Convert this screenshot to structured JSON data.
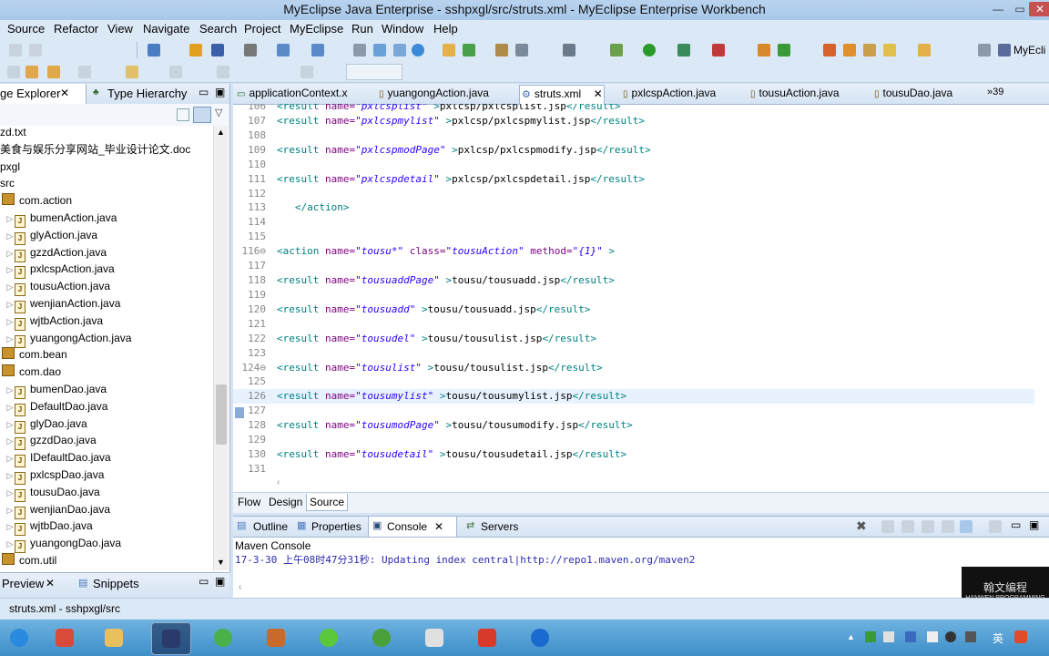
{
  "window": {
    "title": "MyEclipse Java Enterprise - sshpxgl/src/struts.xml - MyEclipse Enterprise Workbench",
    "minimize": "—",
    "maximize": "▭",
    "close": "✕"
  },
  "menu": [
    "Source",
    "Refactor",
    "View",
    "Navigate",
    "Search",
    "Project",
    "MyEclipse",
    "Run",
    "Window",
    "Help"
  ],
  "toolbar": {
    "perspective_label": "MyEcli",
    "icons": [
      "new-icon",
      "save-icon",
      "run-icon",
      "debug-icon",
      "server-icon",
      "search-icon",
      "open-folder-icon"
    ]
  },
  "left_panel": {
    "tabs": [
      "ge Explorer",
      "Type Hierarchy"
    ],
    "tree": [
      {
        "label": "zd.txt",
        "kind": "file",
        "indent": 0
      },
      {
        "label": "美食与娱乐分享网站_毕业设计论文.doc",
        "kind": "file",
        "indent": 0
      },
      {
        "label": "pxgl",
        "kind": "project",
        "indent": 0
      },
      {
        "label": "src",
        "kind": "folder",
        "indent": 0
      },
      {
        "label": "com.action",
        "kind": "package",
        "indent": 1
      },
      {
        "label": "bumenAction.java",
        "kind": "java",
        "indent": 2
      },
      {
        "label": "glyAction.java",
        "kind": "java",
        "indent": 2
      },
      {
        "label": "gzzdAction.java",
        "kind": "java",
        "indent": 2
      },
      {
        "label": "pxlcspAction.java",
        "kind": "java",
        "indent": 2
      },
      {
        "label": "tousuAction.java",
        "kind": "java",
        "indent": 2
      },
      {
        "label": "wenjianAction.java",
        "kind": "java",
        "indent": 2
      },
      {
        "label": "wjtbAction.java",
        "kind": "java",
        "indent": 2
      },
      {
        "label": "yuangongAction.java",
        "kind": "java",
        "indent": 2
      },
      {
        "label": "com.bean",
        "kind": "package",
        "indent": 1
      },
      {
        "label": "com.dao",
        "kind": "package",
        "indent": 1
      },
      {
        "label": "bumenDao.java",
        "kind": "java",
        "indent": 2
      },
      {
        "label": "DefaultDao.java",
        "kind": "java",
        "indent": 2
      },
      {
        "label": "glyDao.java",
        "kind": "java",
        "indent": 2
      },
      {
        "label": "gzzdDao.java",
        "kind": "java",
        "indent": 2
      },
      {
        "label": "IDefaultDao.java",
        "kind": "java",
        "indent": 2
      },
      {
        "label": "pxlcspDao.java",
        "kind": "java",
        "indent": 2
      },
      {
        "label": "tousuDao.java",
        "kind": "java",
        "indent": 2
      },
      {
        "label": "wenjianDao.java",
        "kind": "java",
        "indent": 2
      },
      {
        "label": "wjtbDao.java",
        "kind": "java",
        "indent": 2
      },
      {
        "label": "yuangongDao.java",
        "kind": "java",
        "indent": 2
      },
      {
        "label": "com.util",
        "kind": "package",
        "indent": 1
      }
    ],
    "bottom_tabs": [
      "Preview",
      "Snippets"
    ]
  },
  "editor": {
    "tabs": [
      {
        "label": "applicationContext.x",
        "active": false
      },
      {
        "label": "yuangongAction.java",
        "active": false
      },
      {
        "label": "struts.xml",
        "active": true
      },
      {
        "label": "pxlcspAction.java",
        "active": false
      },
      {
        "label": "tousuAction.java",
        "active": false
      },
      {
        "label": "tousuDao.java",
        "active": false
      }
    ],
    "overflow_count": "»39",
    "lines": [
      {
        "n": "106",
        "indent": "",
        "name": "pxlcsplist",
        "path": "pxlcsp/pxlcsplist.jsp"
      },
      {
        "n": "107",
        "indent": "",
        "name": "pxlcspmylist",
        "path": "pxlcsp/pxlcspmylist.jsp"
      },
      {
        "n": "108",
        "indent": "",
        "blank": true
      },
      {
        "n": "109",
        "indent": "",
        "name": "pxlcspmodPage",
        "path": "pxlcsp/pxlcspmodify.jsp"
      },
      {
        "n": "110",
        "indent": "",
        "blank": true
      },
      {
        "n": "111",
        "indent": "",
        "name": "pxlcspdetail",
        "path": "pxlcsp/pxlcspdetail.jsp"
      },
      {
        "n": "112",
        "indent": "",
        "blank": true
      },
      {
        "n": "113",
        "indent": "   ",
        "raw": "</action>"
      },
      {
        "n": "114",
        "indent": "",
        "blank": true
      },
      {
        "n": "115",
        "indent": "",
        "blank": true
      },
      {
        "n": "116⊖",
        "indent": "",
        "action": true,
        "a_name": "tousu*",
        "a_class": "tousuAction",
        "a_method": "{1}"
      },
      {
        "n": "117",
        "indent": "",
        "blank": true
      },
      {
        "n": "118",
        "indent": "",
        "name": "tousuaddPage",
        "path": "tousu/tousuadd.jsp"
      },
      {
        "n": "119",
        "indent": "",
        "blank": true
      },
      {
        "n": "120",
        "indent": "",
        "name": "tousuadd",
        "path": "tousu/tousuadd.jsp"
      },
      {
        "n": "121",
        "indent": "",
        "blank": true
      },
      {
        "n": "122",
        "indent": "",
        "name": "tousudel",
        "path": "tousu/tousulist.jsp"
      },
      {
        "n": "123",
        "indent": "",
        "blank": true
      },
      {
        "n": "124⊖",
        "indent": "",
        "name": "tousulist",
        "path": "tousu/tousulist.jsp"
      },
      {
        "n": "125",
        "indent": "",
        "blank": true
      },
      {
        "n": "126",
        "indent": "",
        "name": "tousumylist",
        "path": "tousu/tousumylist.jsp",
        "highlight": true
      },
      {
        "n": "127",
        "indent": "",
        "blank": true
      },
      {
        "n": "128",
        "indent": "",
        "name": "tousumodPage",
        "path": "tousu/tousumodify.jsp"
      },
      {
        "n": "129",
        "indent": "",
        "blank": true
      },
      {
        "n": "130",
        "indent": "",
        "name": "tousudetail",
        "path": "tousu/tousudetail.jsp"
      },
      {
        "n": "131",
        "indent": "",
        "blank": true
      }
    ],
    "view_tabs": [
      "Flow",
      "Design",
      "Source"
    ]
  },
  "bottom_panel": {
    "tabs": [
      "Outline",
      "Properties",
      "Console",
      "Servers"
    ],
    "active_tab": "Console",
    "console_title": "Maven Console",
    "console_line": "17-3-30 上午08时47分31秒: Updating index central|http://repo1.maven.org/maven2"
  },
  "status": {
    "path": "struts.xml - sshpxgl/src"
  },
  "watermark": {
    "text1": "翰文编程",
    "text2": "HANWEN PROGRAMMING"
  },
  "taskbar": {
    "apps": [
      "ie-icon",
      "notepad-icon",
      "explorer-icon",
      "myeclipse-icon",
      "chrome-icon",
      "book-icon",
      "qq-music-icon",
      "android-icon",
      "java-icon",
      "ox-icon",
      "teamviewer-icon"
    ],
    "tray_lang": "英"
  },
  "colors": {
    "tag": "#008080",
    "attribute": "#7f007f",
    "value": "#2a00ff",
    "highlight_line": "#e8f2fe",
    "window_chrome": "#dbe8f5"
  }
}
